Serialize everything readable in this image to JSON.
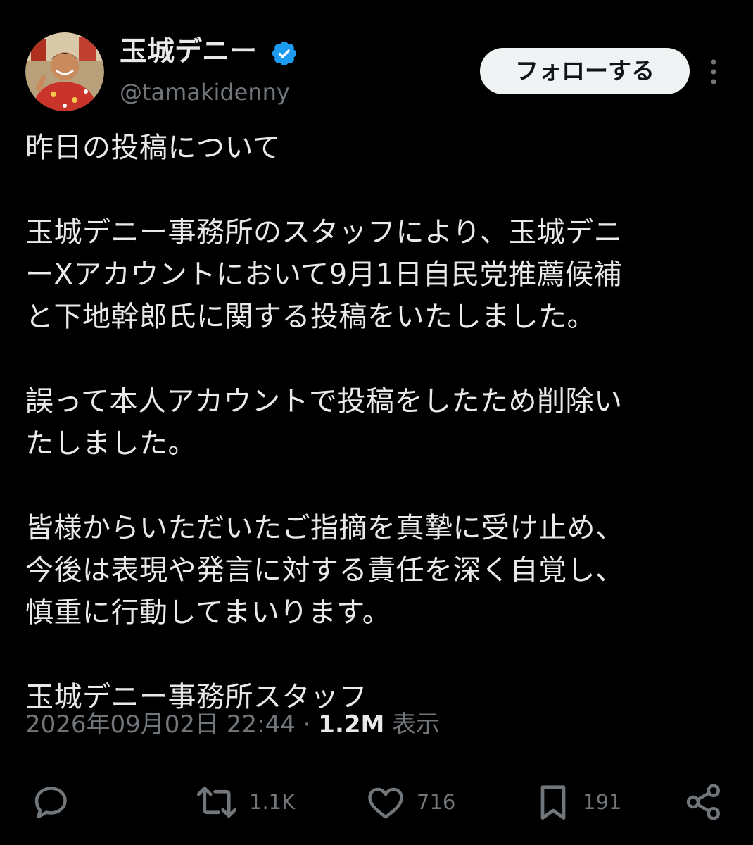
{
  "user": {
    "display_name": "玉城デニー",
    "handle": "@tamakidenny",
    "verified_icon": "verified-badge-icon",
    "avatar_icon": "avatar"
  },
  "header": {
    "follow_label": "フォローする",
    "more_icon": "more-vertical-icon"
  },
  "tweet": {
    "text": "昨日の投稿について\n\n玉城デニー事務所のスタッフにより、玉城デニ\nーXアカウントにおいて9月1日自民党推薦候補\nと下地幹郎氏に関する投稿をいたしました。\n\n誤って本人アカウントで投稿をしたため削除い\nたしました。\n\n皆様からいただいたご指摘を真摯に受け止め、\n今後は表現や発言に対する責任を深く自覚し、\n慎重に行動してまいります。\n\n玉城デニー事務所スタッフ"
  },
  "meta": {
    "timestamp": "2026年09月02日 22:44",
    "separator": "·",
    "views_count": "1.2M",
    "views_label": "表示"
  },
  "actions": {
    "reply_icon": "reply-icon",
    "retweet_icon": "retweet-icon",
    "retweet_count": "1.1K",
    "like_icon": "heart-icon",
    "like_count": "716",
    "bookmark_icon": "bookmark-icon",
    "bookmark_count": "191",
    "share_icon": "share-icon"
  },
  "colors": {
    "background": "#000000",
    "text_primary": "#e7e9ea",
    "text_secondary": "#71767b",
    "verified_blue": "#1d9bf0",
    "follow_button_bg": "#eff3f4"
  }
}
